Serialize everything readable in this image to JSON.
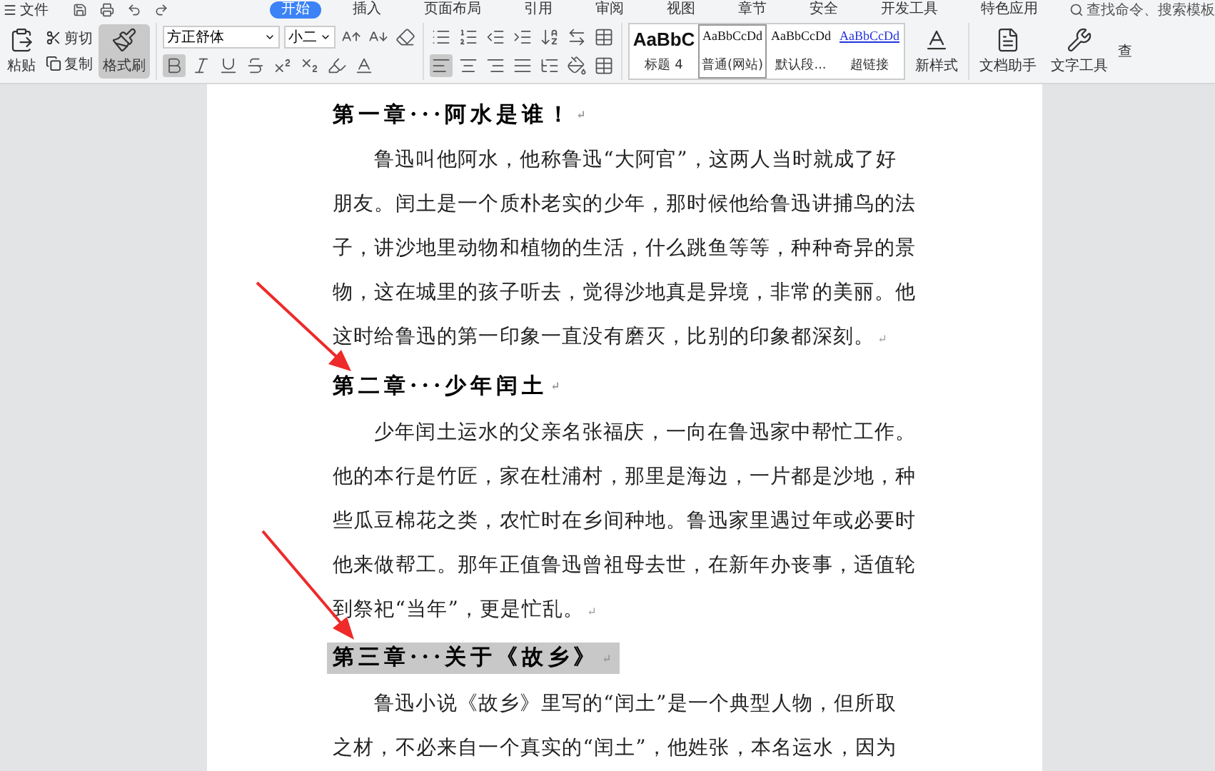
{
  "menu_bar": {
    "file_menu": "文件",
    "tabs": [
      {
        "label": "开始",
        "selected": true
      },
      {
        "label": "插入",
        "selected": false
      },
      {
        "label": "页面布局",
        "selected": false
      },
      {
        "label": "引用",
        "selected": false
      },
      {
        "label": "审阅",
        "selected": false
      },
      {
        "label": "视图",
        "selected": false
      },
      {
        "label": "章节",
        "selected": false
      },
      {
        "label": "安全",
        "selected": false
      },
      {
        "label": "开发工具",
        "selected": false
      },
      {
        "label": "特色应用",
        "selected": false
      }
    ],
    "search": {
      "placeholder": "查找命令、搜索模板"
    }
  },
  "ribbon": {
    "clipboard": {
      "paste": "粘贴",
      "cut": "剪切",
      "copy": "复制",
      "format_painter": {
        "label": "格式刷",
        "selected": true
      }
    },
    "font": {
      "family": "方正舒体",
      "size": "小二",
      "bold_selected": true
    },
    "paragraph": {
      "align_left_selected": true
    },
    "styles": [
      {
        "sample": "AaBbC",
        "label": "标题 4",
        "kind": "heading",
        "selected": false
      },
      {
        "sample": "AaBbCcDd",
        "label": "普通(网站)",
        "kind": "normal",
        "selected": true
      },
      {
        "sample": "AaBbCcDd",
        "label": "默认段...",
        "kind": "normal",
        "selected": false
      },
      {
        "sample": "AaBbCcDd",
        "label": "超链接",
        "kind": "link",
        "selected": false
      }
    ],
    "new_style": "新样式",
    "doc_assistant": "文档助手",
    "text_tools": "文字工具",
    "cut_button": "查"
  },
  "document": {
    "blocks": [
      {
        "kind": "heading",
        "text": "第一章···阿水是谁！",
        "selected": false,
        "end_mark": "↵"
      },
      {
        "kind": "paragraph",
        "lines": [
          "鲁迅叫他阿水，他称鲁迅“大阿官”，这两人当时就成了好",
          "朋友。闰土是一个质朴老实的少年，那时候他给鲁迅讲捕鸟的法",
          "子，讲沙地里动物和植物的生活，什么跳鱼等等，种种奇异的景",
          "物，这在城里的孩子听去，觉得沙地真是异境，非常的美丽。他",
          "这时给鲁迅的第一印象一直没有磨灭，比别的印象都深刻。"
        ],
        "end_mark": "↵"
      },
      {
        "kind": "heading",
        "text": "第二章···少年闰土",
        "selected": false,
        "end_mark": "↵"
      },
      {
        "kind": "paragraph",
        "lines": [
          "少年闰土运水的父亲名张福庆，一向在鲁迅家中帮忙工作。",
          "他的本行是竹匠，家在杜浦村，那里是海边，一片都是沙地，种",
          "些瓜豆棉花之类，农忙时在乡间种地。鲁迅家里遇过年或必要时",
          "他来做帮工。那年正值鲁迅曾祖母去世，在新年办丧事，适值轮",
          "到祭祀“当年”，更是忙乱。"
        ],
        "end_mark": "↵"
      },
      {
        "kind": "heading",
        "text": "第三章···关于《故乡》",
        "selected": true,
        "end_mark": "↵"
      },
      {
        "kind": "paragraph",
        "lines": [
          "鲁迅小说《故乡》里写的“闰土”是一个典型人物，但所取",
          "之材，不必来自一个真实的“闰土”，他姓张，本名运水，因为"
        ]
      }
    ]
  }
}
